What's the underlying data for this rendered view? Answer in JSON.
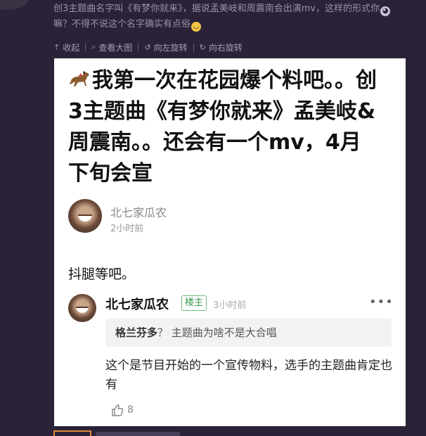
{
  "top": {
    "text_before_emoji": "创3主题曲名字叫《有梦你就来》，据说孟美岐和周震南会出演mv，这样的形式你",
    "text_after_emoji": "嘛？不得不说这个名字确实有点俗"
  },
  "toolbar": {
    "collapse_label": "收起",
    "view_large_label": "查看大图",
    "rotate_left_label": "向左旋转",
    "rotate_right_label": "向右旋转"
  },
  "post": {
    "headline": "我第一次在花园爆个料吧。。创3主题曲《有梦你就来》孟美岐&周震南。。还会有一个mv，4月下旬会宣",
    "author_name": "北七家瓜农",
    "author_time": "2小时前",
    "body": "抖腿等吧。"
  },
  "comment": {
    "name": "北七家瓜农",
    "badge": "楼主",
    "time": "3小时前",
    "more": "•••",
    "quote_user": "格兰芬多",
    "quote_text": "？ 主题曲为啥不是大合唱",
    "reply": "这个是节目开始的一个宣传物料，选手的主题曲肯定也有",
    "likes": "8"
  },
  "colors": {
    "page_bg": "#2b2238",
    "card_bg": "#ffffff",
    "badge_green": "#3a9a4e"
  },
  "icons": [
    "horse-emoji-icon",
    "collapse-arrow-icon",
    "search-icon",
    "rotate-left-icon",
    "rotate-right-icon",
    "more-dots-icon",
    "thumbs-up-icon"
  ]
}
